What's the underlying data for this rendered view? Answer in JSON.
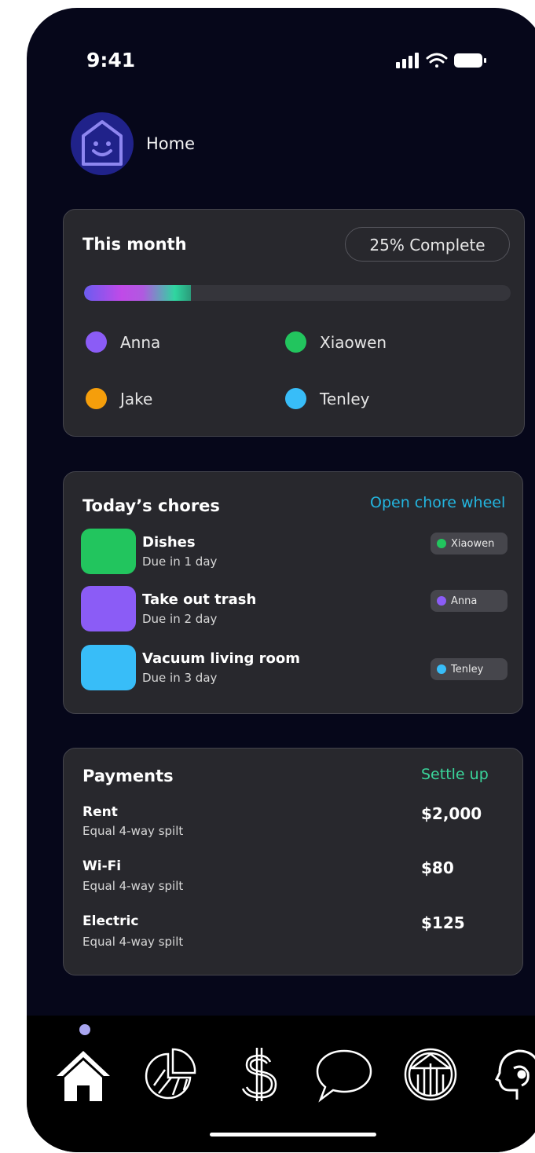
{
  "status_bar": {
    "time": "9:41"
  },
  "header": {
    "title": "Home",
    "avatar_icon": "smiley-house-icon"
  },
  "progress_card": {
    "title": "This month",
    "badge": "25% Complete",
    "progress": 0.25,
    "members": [
      {
        "name": "Anna",
        "color": "#8b5cf6"
      },
      {
        "name": "Xiaowen",
        "color": "#22c55e"
      },
      {
        "name": "Jake",
        "color": "#f59e0b"
      },
      {
        "name": "Tenley",
        "color": "#38bdf8"
      }
    ]
  },
  "chores_card": {
    "title": "Today’s chores",
    "link": "Open chore wheel",
    "link_color": "#23b6e0",
    "chores": [
      {
        "name": "Dishes",
        "due": "Due in 1 day",
        "assignee": "Xiaowen",
        "color": "#22c55e"
      },
      {
        "name": "Take out trash",
        "due": "Due in 2 day",
        "assignee": "Anna",
        "color": "#8b5cf6"
      },
      {
        "name": "Vacuum living room",
        "due": "Due in 3 day",
        "assignee": "Tenley",
        "color": "#38bdf8"
      }
    ]
  },
  "payments_card": {
    "title": "Payments",
    "link": "Settle up",
    "link_color": "#3ad49a",
    "items": [
      {
        "name": "Rent",
        "split": "Equal 4-way spilt",
        "amount": "$2,000"
      },
      {
        "name": "Wi-Fi",
        "split": "Equal 4-way spilt",
        "amount": "$80"
      },
      {
        "name": "Electric",
        "split": "Equal 4-way spilt",
        "amount": "$125"
      }
    ]
  },
  "tab_bar": {
    "tabs": [
      "home-icon",
      "pie-chart-icon",
      "dollar-icon",
      "chat-bubble-icon",
      "building-icon",
      "head-icon"
    ],
    "active": 0
  }
}
